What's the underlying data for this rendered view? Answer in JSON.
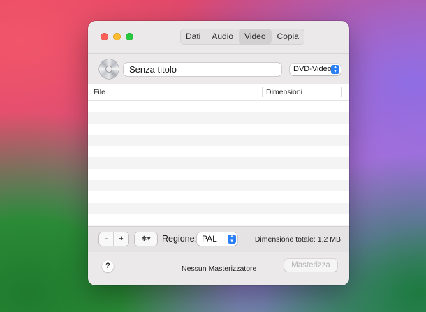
{
  "window": {
    "tabs": [
      {
        "label": "Dati",
        "active": false
      },
      {
        "label": "Audio",
        "active": false
      },
      {
        "label": "Video",
        "active": true
      },
      {
        "label": "Copia",
        "active": false
      }
    ]
  },
  "project": {
    "disc_icon": "dvd-disc-icon",
    "title_value": "Senza titolo",
    "format_value": "DVD-Video"
  },
  "table": {
    "columns": [
      "File",
      "Dimensioni"
    ],
    "rows": []
  },
  "bottom_bar": {
    "remove_label": "-",
    "add_label": "+",
    "gear_label": "✱▾",
    "region_label": "Regione:",
    "region_value": "PAL",
    "total_size": "Dimensione totale: 1,2 MB"
  },
  "footer": {
    "help_label": "?",
    "status": "Nessun Masterizzatore",
    "burn_label": "Masterizza"
  },
  "colors": {
    "accent": "#2a7ef6",
    "close": "#fe5f57",
    "minimize": "#febc2e",
    "zoom": "#28c840"
  }
}
